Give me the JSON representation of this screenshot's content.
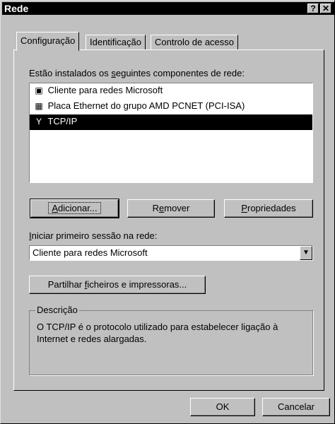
{
  "window": {
    "title": "Rede",
    "help_button": "?",
    "close_button": "✕"
  },
  "tabs": [
    {
      "label": "Configuração",
      "active": true
    },
    {
      "label": "Identificação",
      "active": false
    },
    {
      "label": "Controlo de acesso",
      "active": false
    }
  ],
  "components": {
    "heading_pre": "Estão instalados os ",
    "heading_ul": "s",
    "heading_post": "eguintes componentes de rede:",
    "items": [
      {
        "label": "Cliente para redes Microsoft",
        "icon": "computer-icon",
        "selected": false
      },
      {
        "label": "Placa Ethernet do grupo AMD PCNET (PCI-ISA)",
        "icon": "network-card-icon",
        "selected": false
      },
      {
        "label": "TCP/IP",
        "icon": "protocol-icon",
        "selected": true
      }
    ]
  },
  "buttons": {
    "add_ul": "A",
    "add_rest": "dicionar...",
    "remove_pre": "R",
    "remove_ul": "e",
    "remove_post": "mover",
    "properties_ul": "P",
    "properties_rest": "ropriedades",
    "share_pre": "Partilhar ",
    "share_ul": "f",
    "share_post": "icheiros e impressoras..."
  },
  "logon": {
    "label_ul": "I",
    "label_rest": "niciar primeiro sessão na rede:",
    "selected_value": "Cliente para redes Microsoft"
  },
  "description": {
    "title": "Descrição",
    "text": "O TCP/IP é o protocolo utilizado para estabelecer ligação à Internet e redes alargadas."
  },
  "footer": {
    "ok": "OK",
    "cancel": "Cancelar"
  }
}
